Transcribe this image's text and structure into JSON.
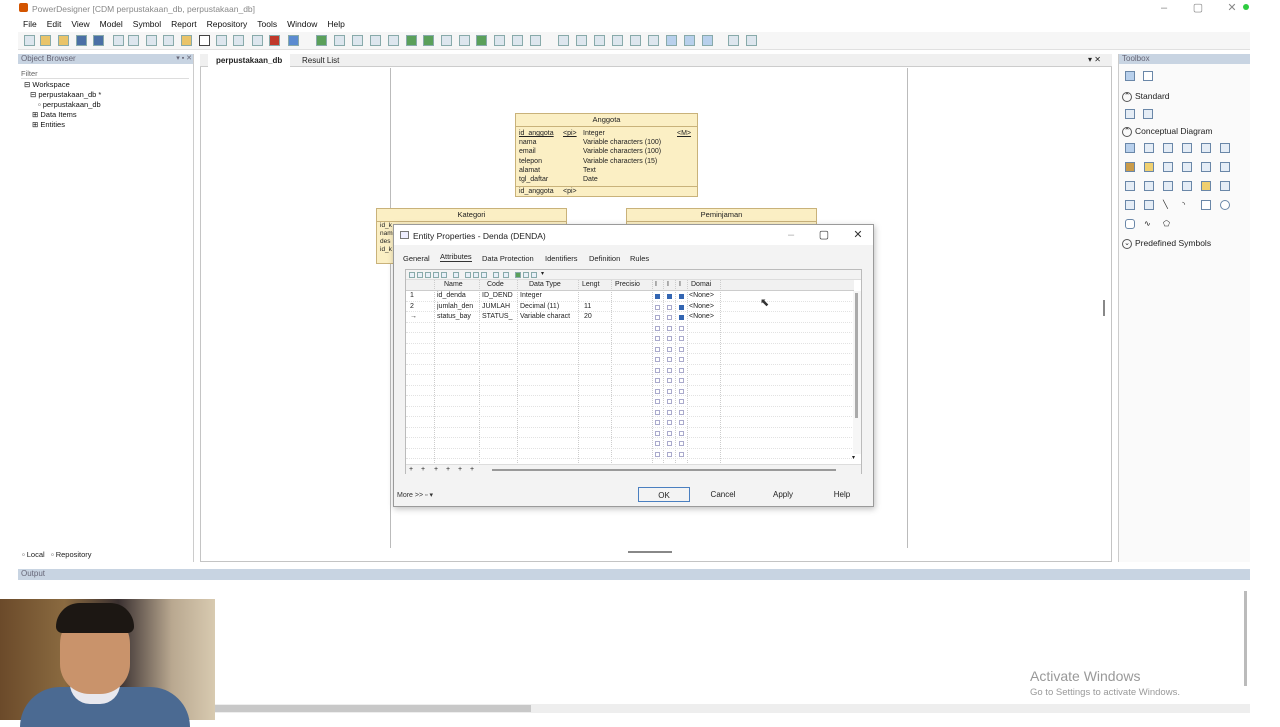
{
  "window": {
    "title": "PowerDesigner [CDM perpustakaan_db, perpustakaan_db]"
  },
  "menu": [
    "File",
    "Edit",
    "View",
    "Model",
    "Symbol",
    "Report",
    "Repository",
    "Tools",
    "Window",
    "Help"
  ],
  "object_browser": {
    "title": "Object Browser",
    "filter": "Filter",
    "tree": [
      "Workspace",
      "perpustakaan_db *",
      "perpustakaan_db",
      "Data Items",
      "Entities"
    ],
    "tabs": {
      "local": "Local",
      "repository": "Repository"
    }
  },
  "document_tabs": {
    "active": "perpustakaan_db",
    "other": "Result List"
  },
  "diagram": {
    "anggota": {
      "name": "Anggota",
      "rows": [
        {
          "n": "id_anggota",
          "k": "<pi>",
          "t": "Integer",
          "m": "<M>"
        },
        {
          "n": "nama",
          "k": "",
          "t": "Variable characters (100)",
          "m": ""
        },
        {
          "n": "email",
          "k": "",
          "t": "Variable characters (100)",
          "m": ""
        },
        {
          "n": "telepon",
          "k": "",
          "t": "Variable characters (15)",
          "m": ""
        },
        {
          "n": "alamat",
          "k": "",
          "t": "Text",
          "m": ""
        },
        {
          "n": "tgl_daftar",
          "k": "",
          "t": "Date",
          "m": ""
        }
      ],
      "identifier": "id_anggota",
      "identifier_tag": "<pi>"
    },
    "kategori": {
      "name": "Kategori",
      "rows": [
        "id_k",
        "nam",
        "des",
        "id_k"
      ]
    },
    "peminjaman": {
      "name": "Peminjaman"
    }
  },
  "toolbox": {
    "title": "Toolbox",
    "sections": [
      "Standard",
      "Conceptual Diagram",
      "Predefined Symbols"
    ]
  },
  "output": {
    "title": "Output"
  },
  "dialog": {
    "title": "Entity Properties - Denda (DENDA)",
    "tabs": [
      "General",
      "Attributes",
      "Data Protection",
      "Identifiers",
      "Definition",
      "Rules"
    ],
    "active_tab": "Attributes",
    "columns": [
      "Name",
      "Code",
      "Data Type",
      "Lengt",
      "Precisio",
      "I",
      "I",
      "I",
      "Domai"
    ],
    "rows": [
      {
        "num": "1",
        "name": "id_denda",
        "code": "ID_DEND",
        "type": "Integer",
        "len": "",
        "prec": "",
        "c1": true,
        "c2": true,
        "c3": true,
        "domain": "<None>"
      },
      {
        "num": "2",
        "name": "jumlah_den",
        "code": "JUMLAH",
        "type": "Decimal (11)",
        "len": "11",
        "prec": "",
        "c1": false,
        "c2": false,
        "c3": true,
        "domain": "<None>"
      },
      {
        "num": "→",
        "name": "status_bay",
        "code": "STATUS_",
        "type": "Variable charact",
        "len": "20",
        "prec": "",
        "c1": false,
        "c2": false,
        "c3": true,
        "domain": "<None>"
      }
    ],
    "footer_tools": [
      "+",
      "+",
      "+",
      "+",
      "+",
      "+"
    ],
    "more": "More >>",
    "buttons": {
      "ok": "OK",
      "cancel": "Cancel",
      "apply": "Apply",
      "help": "Help"
    }
  },
  "watermark": {
    "line1": "Activate Windows",
    "line2": "Go to Settings to activate Windows."
  }
}
